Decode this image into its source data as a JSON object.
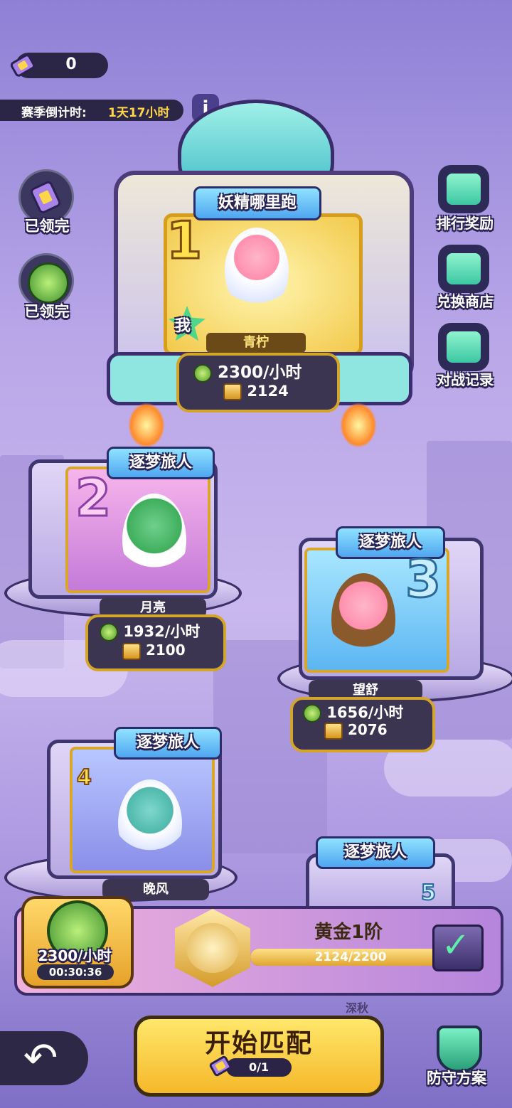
{
  "top": {
    "ticket_count": "0",
    "season_label": "赛季倒计时:",
    "season_value": "1天17小时",
    "info_icon": "info-icon"
  },
  "left_rewards": [
    {
      "label": "已领完",
      "icon": "ticket-icon"
    },
    {
      "label": "已领完",
      "icon": "win-coin-icon"
    }
  ],
  "right_menu": [
    {
      "label": "排行奖励",
      "icon": "gift-icon"
    },
    {
      "label": "兑换商店",
      "icon": "shop-icon"
    },
    {
      "label": "对战记录",
      "icon": "record-icon"
    }
  ],
  "podiums": [
    {
      "rank": "1",
      "title": "妖精哪里跑",
      "me_badge": "我",
      "name": "青柠",
      "rate": "2300/小时",
      "score": "2124"
    },
    {
      "rank": "2",
      "title": "逐梦旅人",
      "name": "月亮",
      "rate": "1932/小时",
      "score": "2100"
    },
    {
      "rank": "3",
      "title": "逐梦旅人",
      "name": "望舒",
      "rate": "1656/小时",
      "score": "2076"
    },
    {
      "rank": "4",
      "title": "逐梦旅人",
      "name": "晚风"
    },
    {
      "rank": "5",
      "title": "逐梦旅人"
    }
  ],
  "bottom": {
    "win_rate": "2300/小时",
    "win_timer": "00:30:36",
    "tier_name": "黄金1阶",
    "progress_text": "2124/2200",
    "progress_fraction": 0.965,
    "season_name": "深秋",
    "start_label": "开始匹配",
    "start_cost": "0/1",
    "defense_label": "防守方案"
  },
  "colors": {
    "accent_gold": "#ffd64a",
    "panel_dark": "#2b2646",
    "banner_blue": "#4fa6f0"
  }
}
